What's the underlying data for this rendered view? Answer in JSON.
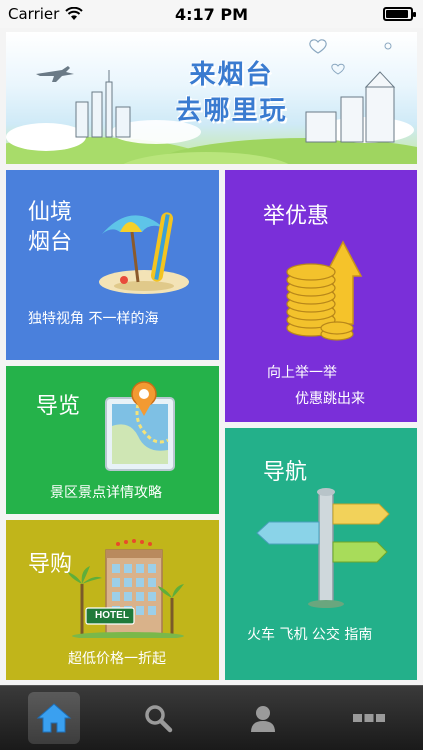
{
  "status_bar": {
    "carrier": "Carrier",
    "time": "4:17 PM",
    "battery_level": 0.85
  },
  "banner": {
    "title_line1": "来烟台",
    "title_line2": "去哪里玩"
  },
  "tiles": {
    "xianjing": {
      "title_line1": "仙境",
      "title_line2": "烟台",
      "subtitle": "独特视角  不一样的海",
      "icon": "beach-umbrella-icon",
      "color": "#4a80dc"
    },
    "juyouhui": {
      "title": "举优惠",
      "subtitle_line1": "向上举一举",
      "subtitle_line2": "优惠跳出来",
      "icon": "gold-coins-icon",
      "color": "#7a2fd9"
    },
    "daolan": {
      "title": "导览",
      "subtitle": "景区景点详情攻略",
      "icon": "map-pin-icon",
      "color": "#25b24a"
    },
    "daohang": {
      "title": "导航",
      "subtitle": "火车 飞机 公交 指南",
      "icon": "signpost-icon",
      "color": "#23b08a"
    },
    "daogou": {
      "title": "导购",
      "subtitle": "超低价格一折起",
      "hotel_sign": "HOTEL",
      "icon": "hotel-icon",
      "color": "#c1b51a"
    }
  },
  "tabbar": {
    "tabs": [
      {
        "name": "home",
        "icon": "home-icon",
        "selected": true
      },
      {
        "name": "search",
        "icon": "search-icon",
        "selected": false
      },
      {
        "name": "user",
        "icon": "user-icon",
        "selected": false
      },
      {
        "name": "more",
        "icon": "more-icon",
        "selected": false
      }
    ]
  }
}
